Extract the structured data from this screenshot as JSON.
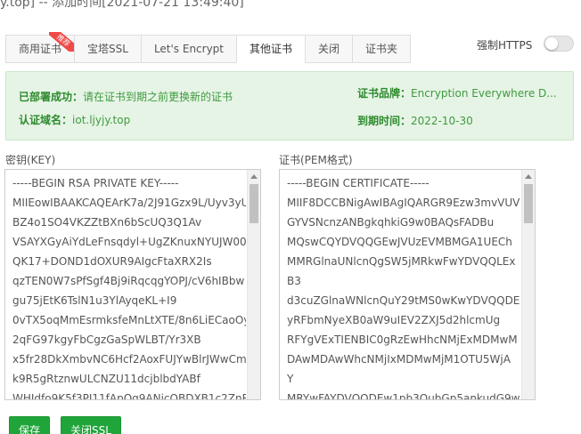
{
  "title": "y.top] -- 添加时间[2021-07-21 13:49:40]",
  "tabs": [
    {
      "label": "商用证书",
      "badge": "推荐"
    },
    {
      "label": "宝塔SSL"
    },
    {
      "label": "Let's Encrypt"
    },
    {
      "label": "其他证书",
      "active": true
    },
    {
      "label": "关闭"
    },
    {
      "label": "证书夹"
    }
  ],
  "force_https": {
    "label": "强制HTTPS",
    "enabled": false
  },
  "info": {
    "deploy_key": "已部署成功：",
    "deploy_val": "请在证书到期之前更换新的证书",
    "brand_key": "证书品牌：",
    "brand_val": "Encryption Everywhere D...",
    "domain_key": "认证域名：",
    "domain_val": "iot.ljyjy.top",
    "expire_key": "到期时间：",
    "expire_val": "2022-10-30"
  },
  "key_label": "密钥(KEY)",
  "cert_label": "证书(PEM格式)",
  "key_content": "-----BEGIN RSA PRIVATE KEY-----\nMIIEowIBAAKCAQEArK7a/2J91Gzx9L/Uyv3yU\nBZ4o1SO4VKZZtBXn6bScUQ3Q1Av\nVSAYXGyAiYdLeFnsqdyl+UgZKnuxNYUJW00\nQK17+DOND1dOXUR9AIgcFtaXRX2Is\nqzTEN0W7sPfSgf4Bj9iRqcqgYOPJ/cV6hIBbw\ngu75jEtK6TslN1u3YlAyqeKL+I9\n0vTX5oqMmEsrmksfeMnLtXTE/8n6LiECaoOy\n2qFG97kgyFbCgzGaSpWLBT/Yr3XB\nx5fr28DkXmbvNC6Hcf2AoxFUJYwBlrJWwCm\nk9R5gRtznwULCNZU11dcjblbdYABf\nWHIdfo9K5f3PJ11fApQq9ANicOBDXB1c2ZnR",
  "cert_content": "-----BEGIN CERTIFICATE-----\nMIIF8DCCBNigAwIBAgIQARGR9Ezw3mvVUV\nGYVSNcnzANBgkqhkiG9w0BAQsFADBu\nMQswCQYDVQQGEwJVUzEVMBMGA1UECh\nMMRGlnaUNlcnQgSW5jMRkwFwYDVQQLEx\nB3\nd3cuZGlnaWNlcnQuY29tMS0wKwYDVQQDE\nyRFbmNyeXB0aW9uIEV2ZXJ5d2hlcmUg\nRFYgVExTIENBIC0gRzEwHhcNMjExMDMwM\nDAwMDAwWhcNMjIxMDMwMjM1OTU5WjA\nY\nMRYwFAYDVQQDEw1pb3QubGp5ankudG9w",
  "buttons": {
    "save": "保存",
    "close_ssl": "关闭SSL"
  }
}
